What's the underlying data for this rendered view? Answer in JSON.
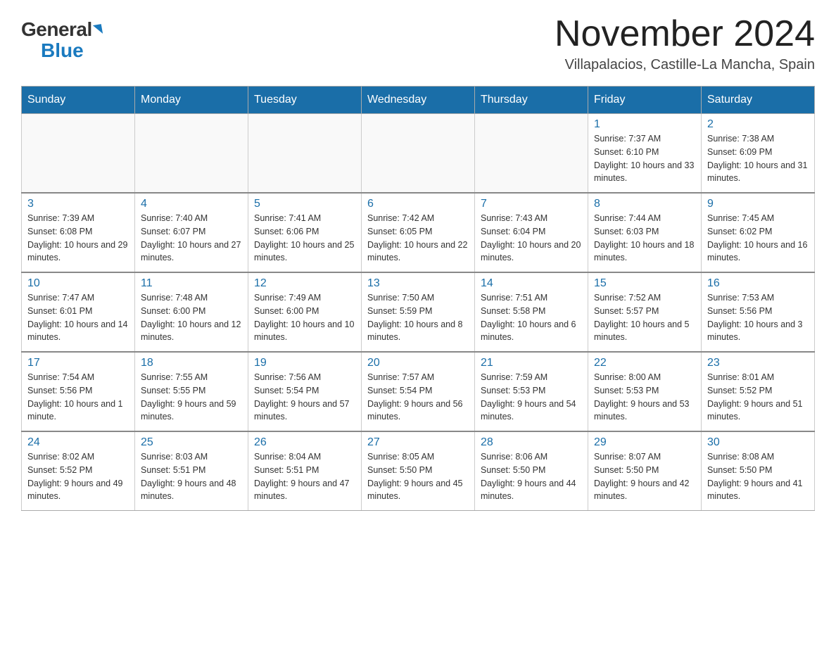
{
  "header": {
    "logo": {
      "general": "General",
      "blue": "Blue"
    },
    "title": "November 2024",
    "location": "Villapalacios, Castille-La Mancha, Spain"
  },
  "calendar": {
    "days_of_week": [
      "Sunday",
      "Monday",
      "Tuesday",
      "Wednesday",
      "Thursday",
      "Friday",
      "Saturday"
    ],
    "weeks": [
      [
        {
          "day": "",
          "info": ""
        },
        {
          "day": "",
          "info": ""
        },
        {
          "day": "",
          "info": ""
        },
        {
          "day": "",
          "info": ""
        },
        {
          "day": "",
          "info": ""
        },
        {
          "day": "1",
          "info": "Sunrise: 7:37 AM\nSunset: 6:10 PM\nDaylight: 10 hours and 33 minutes."
        },
        {
          "day": "2",
          "info": "Sunrise: 7:38 AM\nSunset: 6:09 PM\nDaylight: 10 hours and 31 minutes."
        }
      ],
      [
        {
          "day": "3",
          "info": "Sunrise: 7:39 AM\nSunset: 6:08 PM\nDaylight: 10 hours and 29 minutes."
        },
        {
          "day": "4",
          "info": "Sunrise: 7:40 AM\nSunset: 6:07 PM\nDaylight: 10 hours and 27 minutes."
        },
        {
          "day": "5",
          "info": "Sunrise: 7:41 AM\nSunset: 6:06 PM\nDaylight: 10 hours and 25 minutes."
        },
        {
          "day": "6",
          "info": "Sunrise: 7:42 AM\nSunset: 6:05 PM\nDaylight: 10 hours and 22 minutes."
        },
        {
          "day": "7",
          "info": "Sunrise: 7:43 AM\nSunset: 6:04 PM\nDaylight: 10 hours and 20 minutes."
        },
        {
          "day": "8",
          "info": "Sunrise: 7:44 AM\nSunset: 6:03 PM\nDaylight: 10 hours and 18 minutes."
        },
        {
          "day": "9",
          "info": "Sunrise: 7:45 AM\nSunset: 6:02 PM\nDaylight: 10 hours and 16 minutes."
        }
      ],
      [
        {
          "day": "10",
          "info": "Sunrise: 7:47 AM\nSunset: 6:01 PM\nDaylight: 10 hours and 14 minutes."
        },
        {
          "day": "11",
          "info": "Sunrise: 7:48 AM\nSunset: 6:00 PM\nDaylight: 10 hours and 12 minutes."
        },
        {
          "day": "12",
          "info": "Sunrise: 7:49 AM\nSunset: 6:00 PM\nDaylight: 10 hours and 10 minutes."
        },
        {
          "day": "13",
          "info": "Sunrise: 7:50 AM\nSunset: 5:59 PM\nDaylight: 10 hours and 8 minutes."
        },
        {
          "day": "14",
          "info": "Sunrise: 7:51 AM\nSunset: 5:58 PM\nDaylight: 10 hours and 6 minutes."
        },
        {
          "day": "15",
          "info": "Sunrise: 7:52 AM\nSunset: 5:57 PM\nDaylight: 10 hours and 5 minutes."
        },
        {
          "day": "16",
          "info": "Sunrise: 7:53 AM\nSunset: 5:56 PM\nDaylight: 10 hours and 3 minutes."
        }
      ],
      [
        {
          "day": "17",
          "info": "Sunrise: 7:54 AM\nSunset: 5:56 PM\nDaylight: 10 hours and 1 minute."
        },
        {
          "day": "18",
          "info": "Sunrise: 7:55 AM\nSunset: 5:55 PM\nDaylight: 9 hours and 59 minutes."
        },
        {
          "day": "19",
          "info": "Sunrise: 7:56 AM\nSunset: 5:54 PM\nDaylight: 9 hours and 57 minutes."
        },
        {
          "day": "20",
          "info": "Sunrise: 7:57 AM\nSunset: 5:54 PM\nDaylight: 9 hours and 56 minutes."
        },
        {
          "day": "21",
          "info": "Sunrise: 7:59 AM\nSunset: 5:53 PM\nDaylight: 9 hours and 54 minutes."
        },
        {
          "day": "22",
          "info": "Sunrise: 8:00 AM\nSunset: 5:53 PM\nDaylight: 9 hours and 53 minutes."
        },
        {
          "day": "23",
          "info": "Sunrise: 8:01 AM\nSunset: 5:52 PM\nDaylight: 9 hours and 51 minutes."
        }
      ],
      [
        {
          "day": "24",
          "info": "Sunrise: 8:02 AM\nSunset: 5:52 PM\nDaylight: 9 hours and 49 minutes."
        },
        {
          "day": "25",
          "info": "Sunrise: 8:03 AM\nSunset: 5:51 PM\nDaylight: 9 hours and 48 minutes."
        },
        {
          "day": "26",
          "info": "Sunrise: 8:04 AM\nSunset: 5:51 PM\nDaylight: 9 hours and 47 minutes."
        },
        {
          "day": "27",
          "info": "Sunrise: 8:05 AM\nSunset: 5:50 PM\nDaylight: 9 hours and 45 minutes."
        },
        {
          "day": "28",
          "info": "Sunrise: 8:06 AM\nSunset: 5:50 PM\nDaylight: 9 hours and 44 minutes."
        },
        {
          "day": "29",
          "info": "Sunrise: 8:07 AM\nSunset: 5:50 PM\nDaylight: 9 hours and 42 minutes."
        },
        {
          "day": "30",
          "info": "Sunrise: 8:08 AM\nSunset: 5:50 PM\nDaylight: 9 hours and 41 minutes."
        }
      ]
    ]
  }
}
